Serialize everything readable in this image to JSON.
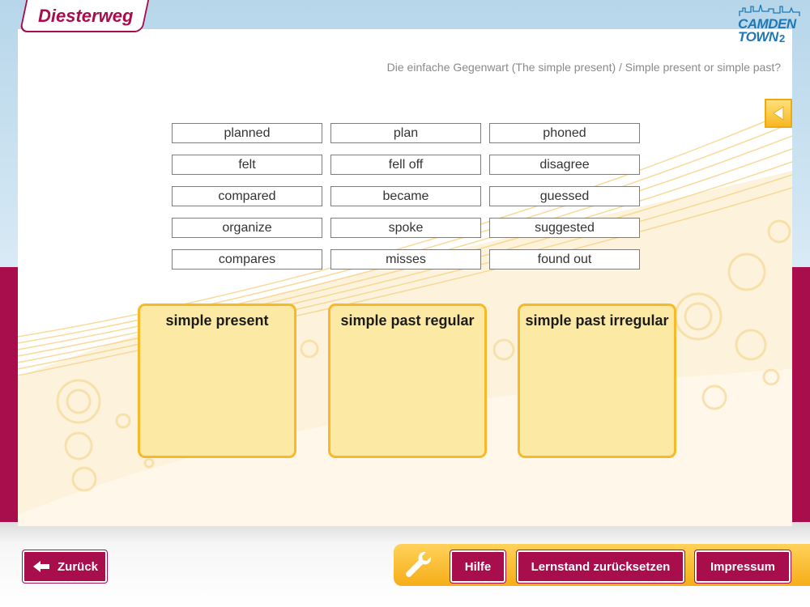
{
  "brand": {
    "publisher": "Diesterweg",
    "series_line1": "CAMDEN",
    "series_line2": "TOWN",
    "series_number": "2"
  },
  "exercise": {
    "title": "Die einfache Gegenwart (The simple present) / Simple present or simple past?"
  },
  "words": [
    [
      "planned",
      "plan",
      "phoned"
    ],
    [
      "felt",
      "fell off",
      "disagree"
    ],
    [
      "compared",
      "became",
      "guessed"
    ],
    [
      "organize",
      "spoke",
      "suggested"
    ],
    [
      "compares",
      "misses",
      "found out"
    ]
  ],
  "categories": [
    "simple present",
    "simple past regular",
    "simple past irregular"
  ],
  "nav": {
    "back_label": "Zurück"
  },
  "toolbar": {
    "help_label": "Hilfe",
    "reset_label": "Lernstand zurücksetzen",
    "imprint_label": "Impressum"
  },
  "icons": {
    "toolbar": "wrench-icon",
    "back": "arrow-left-icon",
    "panel_back": "triangle-left-icon"
  },
  "colors": {
    "brand": "#a80d4c",
    "accent": "#f7b92a",
    "drop_fill": "#fbe9a4",
    "logo_blue": "#1f78b4"
  }
}
